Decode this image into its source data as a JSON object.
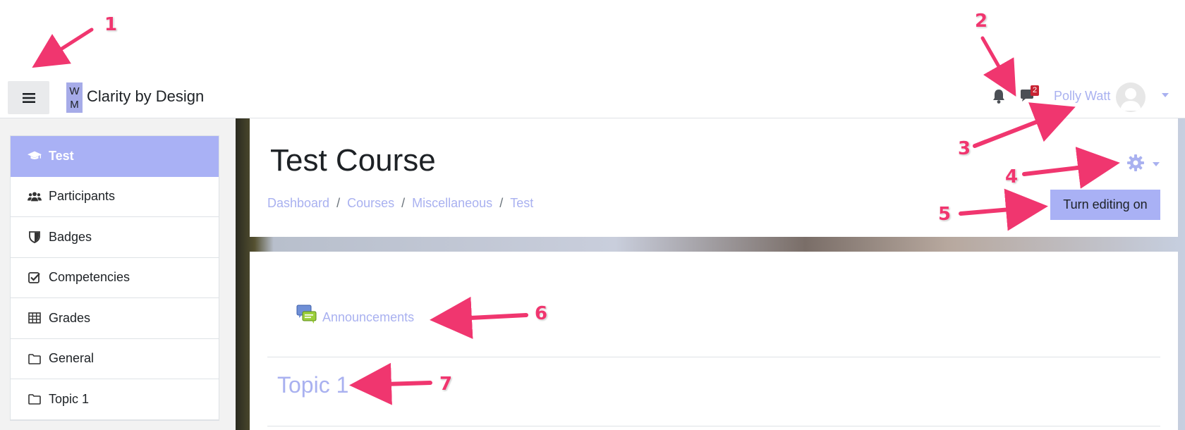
{
  "navbar": {
    "menu_toggle_icon": "hamburger-icon",
    "logo_lines": [
      "W",
      "M"
    ],
    "site_name": "Clarity by Design",
    "notification_icon": "bell-icon",
    "message_icon": "chat-bubble-icon",
    "message_count": "2",
    "user_name": "Polly Watt",
    "user_menu_icon": "caret-down-icon"
  },
  "sidebar": {
    "items": [
      {
        "label": "Test",
        "icon": "graduation-cap-icon",
        "active": true
      },
      {
        "label": "Participants",
        "icon": "users-icon",
        "active": false
      },
      {
        "label": "Badges",
        "icon": "shield-icon",
        "active": false
      },
      {
        "label": "Competencies",
        "icon": "checkbox-icon",
        "active": false
      },
      {
        "label": "Grades",
        "icon": "table-icon",
        "active": false
      },
      {
        "label": "General",
        "icon": "folder-icon",
        "active": false
      },
      {
        "label": "Topic 1",
        "icon": "folder-icon",
        "active": false
      }
    ]
  },
  "course": {
    "title": "Test Course",
    "breadcrumb": [
      "Dashboard",
      "Courses",
      "Miscellaneous",
      "Test"
    ],
    "breadcrumb_separator": "/",
    "settings_icon": "gear-icon",
    "edit_button_label": "Turn editing on",
    "activity_label": "Announcements",
    "activity_icon": "forum-icon",
    "section_title": "Topic 1"
  },
  "annotations": [
    "1",
    "2",
    "3",
    "4",
    "5",
    "6",
    "7"
  ],
  "colors": {
    "accent": "#a9b1f5",
    "link": "#a9b1f0",
    "annotation": "#f0366f",
    "badge": "#c82333"
  }
}
